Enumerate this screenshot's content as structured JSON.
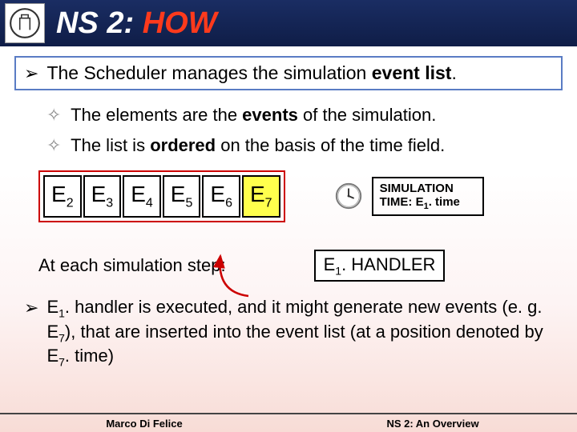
{
  "header": {
    "title_white": "NS 2: ",
    "title_red": "HOW"
  },
  "bullets": {
    "main_pre": "The Scheduler manages the simulation ",
    "main_bold": "event list",
    "main_post": ".",
    "sub1_pre": "The elements are the ",
    "sub1_bold": "events",
    "sub1_post": " of the simulation.",
    "sub2_pre": "The list is ",
    "sub2_bold": "ordered",
    "sub2_post": " on the basis of the time field."
  },
  "events": {
    "e2": {
      "base": "E",
      "sub": "2"
    },
    "e3": {
      "base": "E",
      "sub": "3"
    },
    "e4": {
      "base": "E",
      "sub": "4"
    },
    "e5": {
      "base": "E",
      "sub": "5"
    },
    "e6": {
      "base": "E",
      "sub": "6"
    },
    "e7": {
      "base": "E",
      "sub": "7"
    }
  },
  "sim_time": {
    "label": "SIMULATION TIME: ",
    "val_base": "E",
    "val_sub": "1",
    "val_post": ". time"
  },
  "step_text": "At each simulation step:",
  "handler": {
    "base": "E",
    "sub": "1",
    "post": ". HANDLER"
  },
  "para2": {
    "t1": "E",
    "s1": "1",
    "t2": ". handler is executed, and it might generate new events (e. g. E",
    "s2": "7",
    "t3": "), that are inserted into the event list (at a position denoted by E",
    "s3": "7",
    "t4": ". time)"
  },
  "footer": {
    "left": "Marco Di Felice",
    "right": "NS 2: An Overview"
  }
}
